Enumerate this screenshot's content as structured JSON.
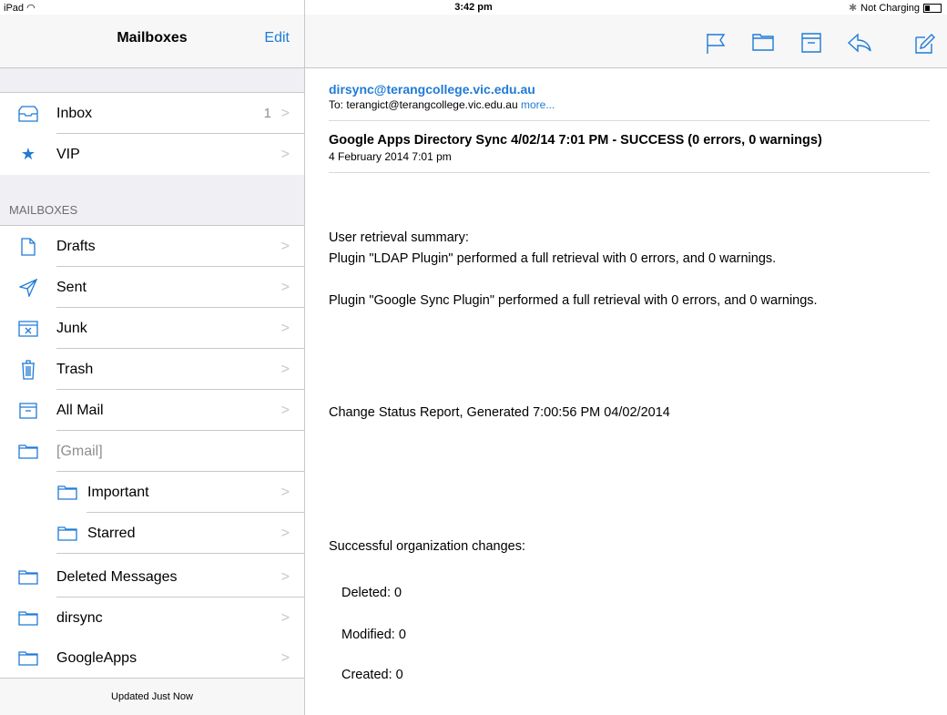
{
  "status_bar": {
    "device": "iPad",
    "time": "3:42 pm",
    "charging": "Not Charging"
  },
  "sidebar": {
    "title": "Mailboxes",
    "edit_label": "Edit",
    "items": [
      {
        "label": "Inbox",
        "count": "1"
      },
      {
        "label": "VIP"
      }
    ],
    "section_header": "MAILBOXES",
    "mailboxes": [
      {
        "label": "Drafts"
      },
      {
        "label": "Sent"
      },
      {
        "label": "Junk"
      },
      {
        "label": "Trash"
      },
      {
        "label": "All Mail"
      },
      {
        "label": "[Gmail]"
      },
      {
        "label": "Important"
      },
      {
        "label": "Starred"
      },
      {
        "label": "Deleted Messages"
      },
      {
        "label": "dirsync"
      },
      {
        "label": "GoogleApps"
      }
    ],
    "footer": "Updated Just Now"
  },
  "toolbar": {
    "icons": [
      "flag-icon",
      "folder-icon",
      "archive-icon",
      "reply-icon",
      "compose-icon"
    ]
  },
  "message": {
    "from": "dirsync@terangcollege.vic.edu.au",
    "to_prefix": "To:",
    "to": "terangict@terangcollege.vic.edu.au",
    "more": "more...",
    "subject": "Google Apps Directory Sync 4/02/14 7:01 PM - SUCCESS (0 errors, 0 warnings)",
    "date": "4 February 2014 7:01 pm",
    "body": {
      "line1": "User retrieval summary:",
      "line2": "Plugin \"LDAP Plugin\" performed a full retrieval with 0 errors, and 0 warnings.",
      "line3": "Plugin \"Google Sync Plugin\" performed a full retrieval with 0 errors, and 0 warnings.",
      "line4": "Change Status Report, Generated 7:00:56 PM 04/02/2014",
      "line5": "Successful organization changes:",
      "deleted": "Deleted: 0",
      "modified": "Modified: 0",
      "created": "Created: 0"
    }
  },
  "colors": {
    "accent": "#1f7bd6",
    "separator": "#c8c7cc",
    "group_bg": "#efeff4"
  }
}
